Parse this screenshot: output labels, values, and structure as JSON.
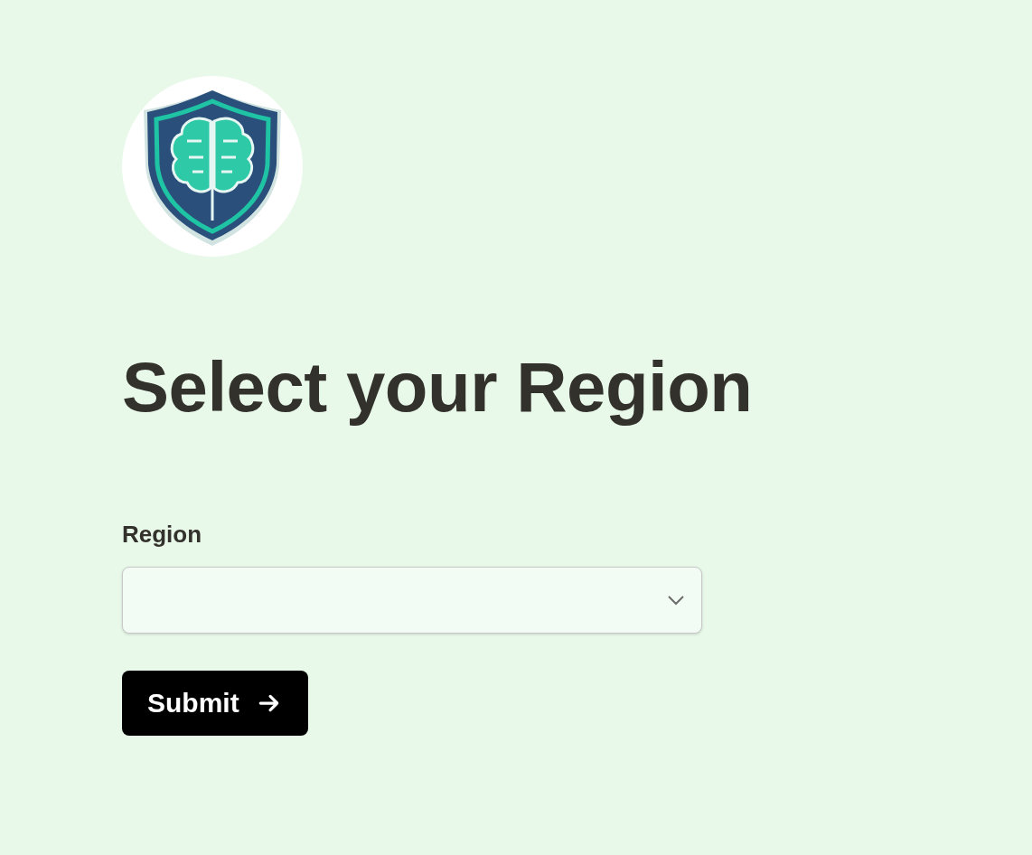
{
  "heading": "Select your Region",
  "form": {
    "field_label": "Region",
    "submit_label": "Submit"
  }
}
